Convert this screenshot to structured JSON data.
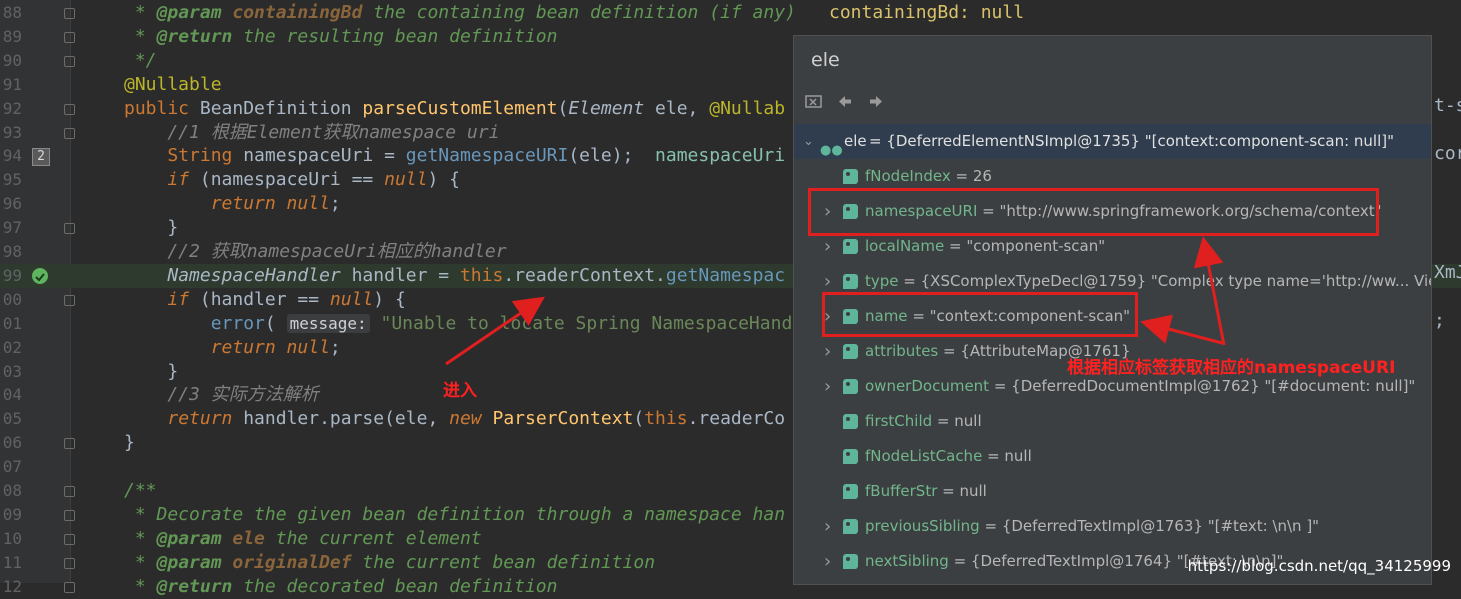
{
  "editor": {
    "top_hint": "containingBd: null",
    "lines": [
      {
        "num": "88",
        "segments": [
          {
            "cls": "c-doc",
            "t": " * "
          },
          {
            "cls": "c-tag",
            "t": "@param "
          },
          {
            "cls": "c-tagval",
            "t": "containingBd"
          },
          {
            "cls": "c-doc",
            "t": " the containing bean definition (if any)"
          }
        ]
      },
      {
        "num": "89",
        "segments": [
          {
            "cls": "c-doc",
            "t": " * "
          },
          {
            "cls": "c-tag",
            "t": "@return"
          },
          {
            "cls": "c-doc",
            "t": " the resulting bean definition"
          }
        ]
      },
      {
        "num": "90",
        "segments": [
          {
            "cls": "c-doc",
            "t": " */"
          }
        ]
      },
      {
        "num": "91",
        "segments": [
          {
            "cls": "c-ann",
            "t": "@Nullable"
          }
        ]
      },
      {
        "num": "92",
        "segments": [
          {
            "cls": "c-kw",
            "t": "public "
          },
          {
            "cls": "c-type",
            "t": "BeanDefinition "
          },
          {
            "cls": "c-fn",
            "t": "parseCustomElement"
          },
          {
            "cls": "c-txt",
            "t": "("
          },
          {
            "cls": "c-cls",
            "t": "Element "
          },
          {
            "cls": "c-txt",
            "t": "ele, "
          },
          {
            "cls": "c-ann",
            "t": "@Nullab"
          }
        ]
      },
      {
        "num": "93",
        "segments": [
          {
            "cls": "c-cmt",
            "t": "    //1 根据Element获取namespace uri"
          }
        ]
      },
      {
        "num": "94",
        "segments": [
          {
            "cls": "c-txt",
            "t": "    "
          },
          {
            "cls": "c-kw",
            "t": "String "
          },
          {
            "cls": "c-txt",
            "t": "namespaceUri = "
          },
          {
            "cls": "c-call",
            "t": "getNamespaceURI"
          },
          {
            "cls": "c-txt",
            "t": "(ele);  "
          },
          {
            "cls": "c-inl",
            "t": "namespaceUri"
          }
        ]
      },
      {
        "num": "95",
        "segments": [
          {
            "cls": "c-txt",
            "t": "    "
          },
          {
            "cls": "c-kwi",
            "t": "if "
          },
          {
            "cls": "c-txt",
            "t": "(namespaceUri == "
          },
          {
            "cls": "c-kwi",
            "t": "null"
          },
          {
            "cls": "c-txt",
            "t": ") {"
          }
        ]
      },
      {
        "num": "96",
        "segments": [
          {
            "cls": "c-txt",
            "t": "        "
          },
          {
            "cls": "c-kwi",
            "t": "return null"
          },
          {
            "cls": "c-txt",
            "t": ";"
          }
        ]
      },
      {
        "num": "97",
        "segments": [
          {
            "cls": "c-txt",
            "t": "    }"
          }
        ]
      },
      {
        "num": "98",
        "segments": [
          {
            "cls": "c-cmt",
            "t": "    //2 获取namespaceUri相应的handler"
          }
        ]
      },
      {
        "num": "99",
        "segments": [
          {
            "cls": "c-txt",
            "t": "    "
          },
          {
            "cls": "c-cls",
            "t": "NamespaceHandler "
          },
          {
            "cls": "c-txt",
            "t": "handler = "
          },
          {
            "cls": "c-this",
            "t": "this"
          },
          {
            "cls": "c-txt",
            "t": ".readerContext."
          },
          {
            "cls": "c-call",
            "t": "getNamespac"
          }
        ]
      },
      {
        "num": "00",
        "segments": [
          {
            "cls": "c-txt",
            "t": "    "
          },
          {
            "cls": "c-kwi",
            "t": "if "
          },
          {
            "cls": "c-txt",
            "t": "(handler == "
          },
          {
            "cls": "c-kwi",
            "t": "null"
          },
          {
            "cls": "c-txt",
            "t": ") {"
          }
        ]
      },
      {
        "num": "01",
        "segments": [
          {
            "cls": "c-txt",
            "t": "        "
          },
          {
            "cls": "c-call",
            "t": "error"
          },
          {
            "cls": "c-txt",
            "t": "( "
          },
          {
            "cls": "c-hint",
            "t": "message:"
          },
          {
            "cls": "c-str",
            "t": " \"Unable to locate Spring NamespaceHand"
          }
        ]
      },
      {
        "num": "02",
        "segments": [
          {
            "cls": "c-txt",
            "t": "        "
          },
          {
            "cls": "c-kwi",
            "t": "return null"
          },
          {
            "cls": "c-txt",
            "t": ";"
          }
        ]
      },
      {
        "num": "03",
        "segments": [
          {
            "cls": "c-txt",
            "t": "    }"
          }
        ]
      },
      {
        "num": "04",
        "segments": [
          {
            "cls": "c-cmt",
            "t": "    //3 实际方法解析"
          }
        ]
      },
      {
        "num": "05",
        "segments": [
          {
            "cls": "c-txt",
            "t": "    "
          },
          {
            "cls": "c-kwi",
            "t": "return "
          },
          {
            "cls": "c-txt",
            "t": "handler.parse(ele, "
          },
          {
            "cls": "c-kwi",
            "t": "new "
          },
          {
            "cls": "c-fn",
            "t": "ParserContext"
          },
          {
            "cls": "c-txt",
            "t": "("
          },
          {
            "cls": "c-this",
            "t": "this"
          },
          {
            "cls": "c-txt",
            "t": ".readerCo"
          }
        ]
      },
      {
        "num": "06",
        "segments": [
          {
            "cls": "c-txt",
            "t": "}"
          }
        ]
      },
      {
        "num": "07",
        "segments": []
      },
      {
        "num": "08",
        "segments": [
          {
            "cls": "c-doc",
            "t": "/**"
          }
        ]
      },
      {
        "num": "09",
        "segments": [
          {
            "cls": "c-doc",
            "t": " * Decorate the given bean definition through a namespace han"
          }
        ]
      },
      {
        "num": "10",
        "segments": [
          {
            "cls": "c-doc",
            "t": " * "
          },
          {
            "cls": "c-tag",
            "t": "@param "
          },
          {
            "cls": "c-tagval",
            "t": "ele"
          },
          {
            "cls": "c-doc",
            "t": " the current element"
          }
        ]
      },
      {
        "num": "11",
        "segments": [
          {
            "cls": "c-doc",
            "t": " * "
          },
          {
            "cls": "c-tag",
            "t": "@param "
          },
          {
            "cls": "c-tagval",
            "t": "originalDef"
          },
          {
            "cls": "c-doc",
            "t": " the current bean definition"
          }
        ]
      },
      {
        "num": "12",
        "segments": [
          {
            "cls": "c-doc",
            "t": " * "
          },
          {
            "cls": "c-tag",
            "t": "@return"
          },
          {
            "cls": "c-doc",
            "t": " the decorated bean definition"
          }
        ]
      }
    ],
    "breakpoint_badge": "2",
    "right_peek": {
      "r92": "t-s",
      "r94": "cor",
      "r99": "XmJ",
      "r101": ";"
    }
  },
  "popup": {
    "title": "ele",
    "toolbar": {
      "remove_icon": "remove-watch-icon",
      "back_icon": "arrow-left-icon",
      "forward_icon": "arrow-right-icon"
    },
    "root": {
      "name": "ele",
      "value": " = {DeferredElementNSImpl@1735} \"[context:component-scan: null]\""
    },
    "fields": [
      {
        "name": "fNodeIndex",
        "value": " = 26",
        "expandable": false
      },
      {
        "name": "namespaceURI",
        "value": " = \"http://www.springframework.org/schema/context\"",
        "expandable": true
      },
      {
        "name": "localName",
        "value": " = \"component-scan\"",
        "expandable": true
      },
      {
        "name": "type",
        "value": " = {XSComplexTypeDecl@1759} \"Complex type name='http://ww... View",
        "expandable": true
      },
      {
        "name": "name",
        "value": " = \"context:component-scan\"",
        "expandable": true
      },
      {
        "name": "attributes",
        "value": " = {AttributeMap@1761}",
        "expandable": true
      },
      {
        "name": "ownerDocument",
        "value": " = {DeferredDocumentImpl@1762} \"[#document: null]\"",
        "expandable": true
      },
      {
        "name": "firstChild",
        "value": " = null",
        "expandable": false
      },
      {
        "name": "fNodeListCache",
        "value": " = null",
        "expandable": false
      },
      {
        "name": "fBufferStr",
        "value": " = null",
        "expandable": false
      },
      {
        "name": "previousSibling",
        "value": " = {DeferredTextImpl@1763} \"[#text: \\n\\n    ]\"",
        "expandable": true
      },
      {
        "name": "nextSibling",
        "value": " = {DeferredTextImpl@1764} \"[#text: \\n\\n]\"",
        "expandable": true
      }
    ]
  },
  "annotations": {
    "enter_label": "进入",
    "namespace_label": "根据相应标签获取相应的namespaceURI"
  },
  "watermark": "https://blog.csdn.net/qq_34125999",
  "colors": {
    "annotation_red": "#e01f1f",
    "selection_bg": "#2f3d4e",
    "field_green": "#72b58c"
  }
}
